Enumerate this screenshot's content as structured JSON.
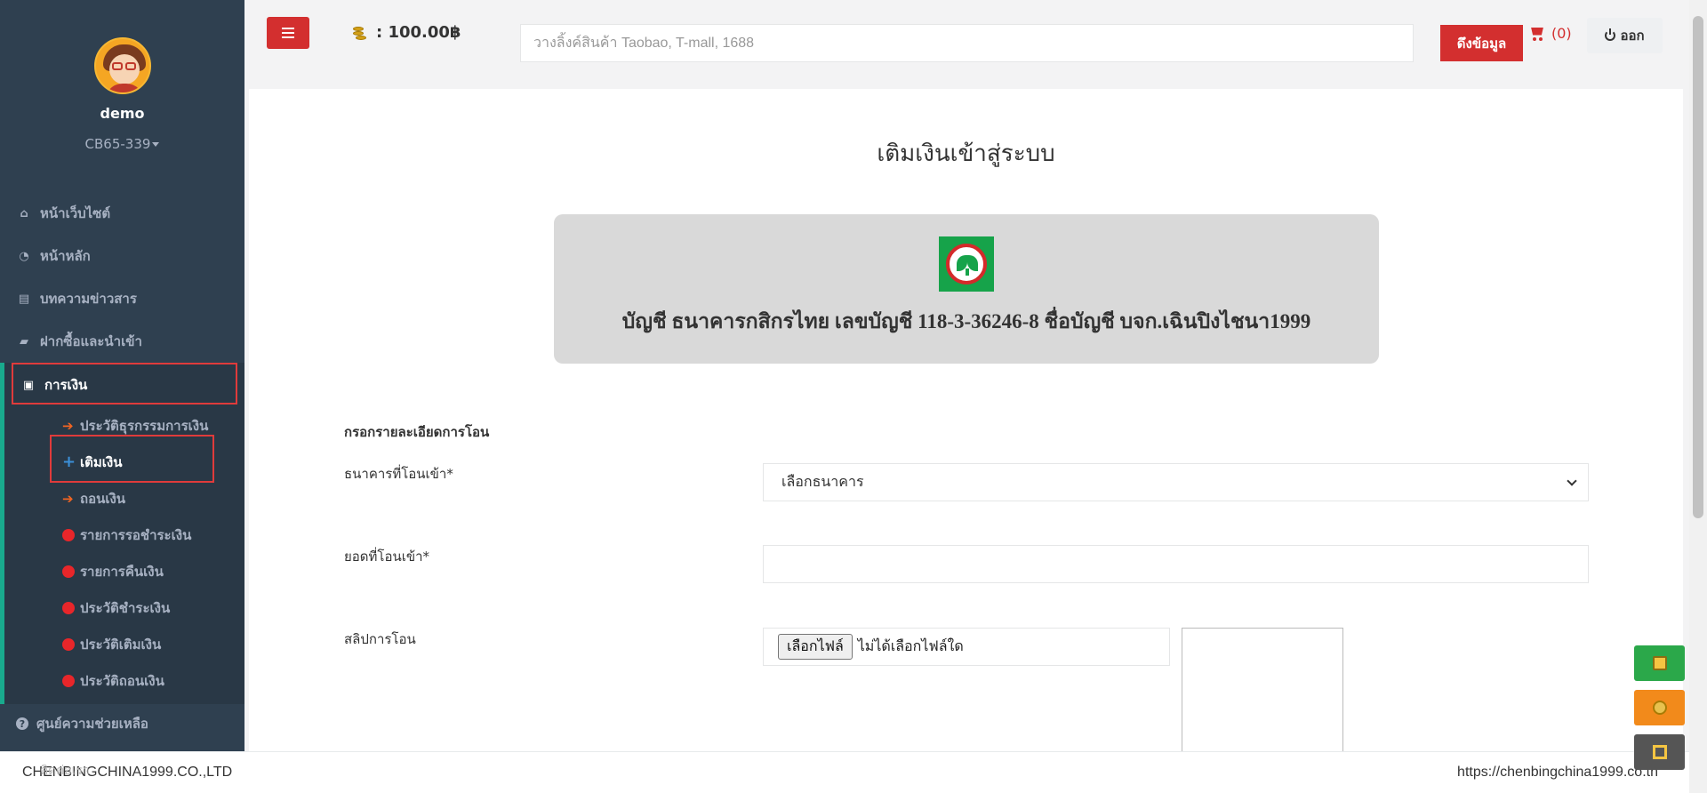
{
  "user": {
    "name": "demo",
    "code": "CB65-339"
  },
  "sidebar": {
    "items": [
      {
        "label": "หน้าเว็บไซต์",
        "icon": "home-icon"
      },
      {
        "label": "หน้าหลัก",
        "icon": "dashboard-icon"
      },
      {
        "label": "บทความข่าวสาร",
        "icon": "newspaper-icon"
      },
      {
        "label": "ฝากซื้อและนำเข้า",
        "icon": "shopping-bag-icon"
      }
    ],
    "finance": {
      "label": "การเงิน",
      "icon": "money-icon",
      "sub_items": [
        {
          "label": "ประวัติธุรกรรมการเงิน",
          "icon": "arrow-right-icon"
        },
        {
          "label": "เติมเงิน",
          "icon": "plus-icon"
        },
        {
          "label": "ถอนเงิน",
          "icon": "arrow-right-icon"
        },
        {
          "label": "รายการรอชำระเงิน",
          "icon": "red-dot-icon"
        },
        {
          "label": "รายการคืนเงิน",
          "icon": "red-dot-icon"
        },
        {
          "label": "ประวัติชำระเงิน",
          "icon": "red-dot-icon"
        },
        {
          "label": "ประวัติเติมเงิน",
          "icon": "red-dot-icon"
        },
        {
          "label": "ประวัติถอนเงิน",
          "icon": "red-dot-icon"
        }
      ]
    },
    "help": {
      "label": "ศูนย์ความช่วยเหลือ",
      "icon": "question-icon"
    }
  },
  "header": {
    "balance": ": 100.00฿",
    "search_placeholder": "วางลิ้งค์สินค้า Taobao, T-mall, 1688",
    "fetch_label": "ดึงข้อมูล",
    "cart_count": "(0)",
    "logout_label": "ออก"
  },
  "main": {
    "title": "เติมเงินเข้าสู่ระบบ",
    "bank_account_text": "บัญชี ธนาคารกสิกรไทย เลขบัญชี 118-3-36246-8 ชื่อบัญชี บจก.เฉินปิงไชนา1999",
    "form": {
      "section_label": "กรอกรายละเอียดการโอน",
      "bank_label": "ธนาคารที่โอนเข้า*",
      "bank_select_value": "เลือกธนาคาร",
      "amount_label": "ยอดที่โอนเข้า*",
      "amount_value": "",
      "slip_label": "สลิปการโอน",
      "file_button_label": "เลือกไฟล์",
      "file_status": "ไม่ได้เลือกไฟล์ใด"
    }
  },
  "footer": {
    "company": "CHENBINGCHINA1999.CO.,LTD",
    "url": "https://chenbingchina1999.co.th",
    "overlay": "ติดต่อเรา"
  },
  "floating_buttons": [
    {
      "icon": "document-icon",
      "color": "#2ba84a"
    },
    {
      "icon": "coins-icon",
      "color": "#f28a1b"
    },
    {
      "icon": "crop-icon",
      "color": "#555555"
    }
  ],
  "colors": {
    "sidebar_bg": "#2f4050",
    "accent_red": "#d32f2f",
    "active_border": "#19aa8d",
    "kbank_green": "#16a34a"
  }
}
